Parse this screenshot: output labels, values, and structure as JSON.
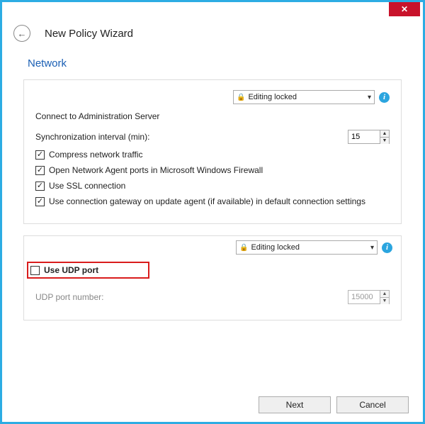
{
  "window": {
    "title": "New Policy Wizard"
  },
  "section": {
    "title": "Network"
  },
  "panel1": {
    "lock_label": "Editing locked",
    "connect_label": "Connect to Administration Server",
    "sync_label": "Synchronization interval (min):",
    "sync_value": "15",
    "compress_label": "Compress network traffic",
    "firewall_label": "Open Network Agent ports in Microsoft Windows Firewall",
    "ssl_label": "Use SSL connection",
    "gateway_label": "Use connection gateway on update agent (if available) in default connection settings"
  },
  "panel2": {
    "lock_label": "Editing locked",
    "use_udp_label": "Use UDP port",
    "udp_num_label": "UDP port number:",
    "udp_num_value": "15000"
  },
  "buttons": {
    "next": "Next",
    "cancel": "Cancel"
  },
  "icons": {
    "info": "i",
    "lock": "🔒",
    "check": "✓",
    "close": "✕",
    "back": "←"
  }
}
